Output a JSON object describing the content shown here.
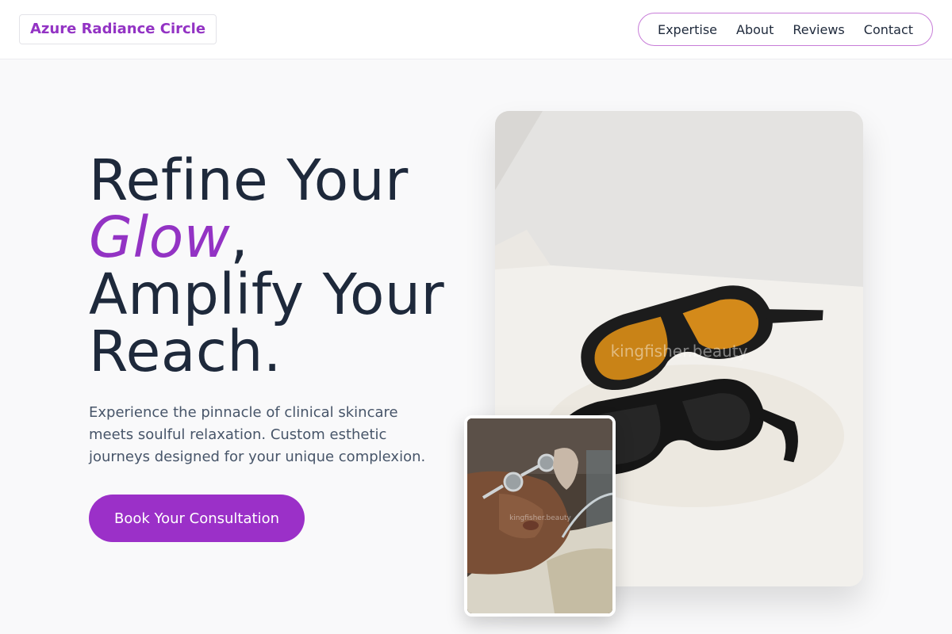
{
  "header": {
    "brand": "Azure Radiance Circle",
    "nav": [
      "Expertise",
      "About",
      "Reviews",
      "Contact"
    ]
  },
  "hero": {
    "line1": "Refine Your",
    "accent_word": "Glow",
    "accent_punct": ",",
    "line3": "Amplify Your",
    "line4": "Reach.",
    "description": "Experience the pinnacle of clinical skincare meets soulful relaxation. Custom esthetic journeys designed for your unique complexion.",
    "cta_label": "Book Your Consultation"
  },
  "images": {
    "main": {
      "subject": "two pairs of laser safety goggles on a white treatment bed",
      "watermark": "kingfisher.beauty"
    },
    "inset": {
      "subject": "client receiving a facial treatment wearing protective eyewear",
      "watermark": "kingfisher.beauty"
    }
  },
  "colors": {
    "accent": "#9333c4",
    "button": "#9b30c8",
    "nav_border": "#c77cd8",
    "text": "#1e293b",
    "muted": "#475569",
    "background": "#f9f9fa"
  },
  "icons": []
}
